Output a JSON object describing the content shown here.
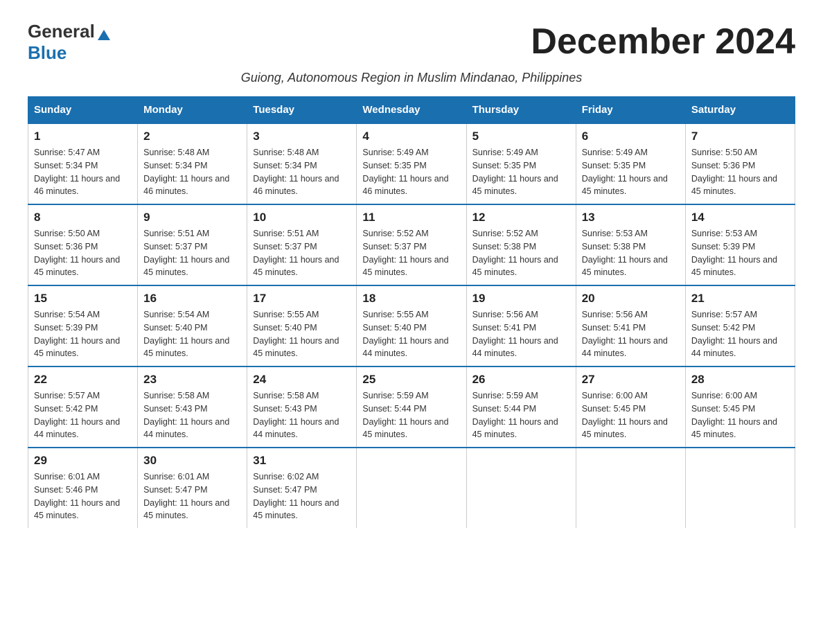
{
  "logo": {
    "general": "General",
    "blue": "Blue"
  },
  "title": "December 2024",
  "subtitle": "Guiong, Autonomous Region in Muslim Mindanao, Philippines",
  "headers": [
    "Sunday",
    "Monday",
    "Tuesday",
    "Wednesday",
    "Thursday",
    "Friday",
    "Saturday"
  ],
  "weeks": [
    [
      {
        "day": "1",
        "sunrise": "5:47 AM",
        "sunset": "5:34 PM",
        "daylight": "11 hours and 46 minutes."
      },
      {
        "day": "2",
        "sunrise": "5:48 AM",
        "sunset": "5:34 PM",
        "daylight": "11 hours and 46 minutes."
      },
      {
        "day": "3",
        "sunrise": "5:48 AM",
        "sunset": "5:34 PM",
        "daylight": "11 hours and 46 minutes."
      },
      {
        "day": "4",
        "sunrise": "5:49 AM",
        "sunset": "5:35 PM",
        "daylight": "11 hours and 46 minutes."
      },
      {
        "day": "5",
        "sunrise": "5:49 AM",
        "sunset": "5:35 PM",
        "daylight": "11 hours and 45 minutes."
      },
      {
        "day": "6",
        "sunrise": "5:49 AM",
        "sunset": "5:35 PM",
        "daylight": "11 hours and 45 minutes."
      },
      {
        "day": "7",
        "sunrise": "5:50 AM",
        "sunset": "5:36 PM",
        "daylight": "11 hours and 45 minutes."
      }
    ],
    [
      {
        "day": "8",
        "sunrise": "5:50 AM",
        "sunset": "5:36 PM",
        "daylight": "11 hours and 45 minutes."
      },
      {
        "day": "9",
        "sunrise": "5:51 AM",
        "sunset": "5:37 PM",
        "daylight": "11 hours and 45 minutes."
      },
      {
        "day": "10",
        "sunrise": "5:51 AM",
        "sunset": "5:37 PM",
        "daylight": "11 hours and 45 minutes."
      },
      {
        "day": "11",
        "sunrise": "5:52 AM",
        "sunset": "5:37 PM",
        "daylight": "11 hours and 45 minutes."
      },
      {
        "day": "12",
        "sunrise": "5:52 AM",
        "sunset": "5:38 PM",
        "daylight": "11 hours and 45 minutes."
      },
      {
        "day": "13",
        "sunrise": "5:53 AM",
        "sunset": "5:38 PM",
        "daylight": "11 hours and 45 minutes."
      },
      {
        "day": "14",
        "sunrise": "5:53 AM",
        "sunset": "5:39 PM",
        "daylight": "11 hours and 45 minutes."
      }
    ],
    [
      {
        "day": "15",
        "sunrise": "5:54 AM",
        "sunset": "5:39 PM",
        "daylight": "11 hours and 45 minutes."
      },
      {
        "day": "16",
        "sunrise": "5:54 AM",
        "sunset": "5:40 PM",
        "daylight": "11 hours and 45 minutes."
      },
      {
        "day": "17",
        "sunrise": "5:55 AM",
        "sunset": "5:40 PM",
        "daylight": "11 hours and 45 minutes."
      },
      {
        "day": "18",
        "sunrise": "5:55 AM",
        "sunset": "5:40 PM",
        "daylight": "11 hours and 44 minutes."
      },
      {
        "day": "19",
        "sunrise": "5:56 AM",
        "sunset": "5:41 PM",
        "daylight": "11 hours and 44 minutes."
      },
      {
        "day": "20",
        "sunrise": "5:56 AM",
        "sunset": "5:41 PM",
        "daylight": "11 hours and 44 minutes."
      },
      {
        "day": "21",
        "sunrise": "5:57 AM",
        "sunset": "5:42 PM",
        "daylight": "11 hours and 44 minutes."
      }
    ],
    [
      {
        "day": "22",
        "sunrise": "5:57 AM",
        "sunset": "5:42 PM",
        "daylight": "11 hours and 44 minutes."
      },
      {
        "day": "23",
        "sunrise": "5:58 AM",
        "sunset": "5:43 PM",
        "daylight": "11 hours and 44 minutes."
      },
      {
        "day": "24",
        "sunrise": "5:58 AM",
        "sunset": "5:43 PM",
        "daylight": "11 hours and 44 minutes."
      },
      {
        "day": "25",
        "sunrise": "5:59 AM",
        "sunset": "5:44 PM",
        "daylight": "11 hours and 45 minutes."
      },
      {
        "day": "26",
        "sunrise": "5:59 AM",
        "sunset": "5:44 PM",
        "daylight": "11 hours and 45 minutes."
      },
      {
        "day": "27",
        "sunrise": "6:00 AM",
        "sunset": "5:45 PM",
        "daylight": "11 hours and 45 minutes."
      },
      {
        "day": "28",
        "sunrise": "6:00 AM",
        "sunset": "5:45 PM",
        "daylight": "11 hours and 45 minutes."
      }
    ],
    [
      {
        "day": "29",
        "sunrise": "6:01 AM",
        "sunset": "5:46 PM",
        "daylight": "11 hours and 45 minutes."
      },
      {
        "day": "30",
        "sunrise": "6:01 AM",
        "sunset": "5:47 PM",
        "daylight": "11 hours and 45 minutes."
      },
      {
        "day": "31",
        "sunrise": "6:02 AM",
        "sunset": "5:47 PM",
        "daylight": "11 hours and 45 minutes."
      },
      null,
      null,
      null,
      null
    ]
  ]
}
